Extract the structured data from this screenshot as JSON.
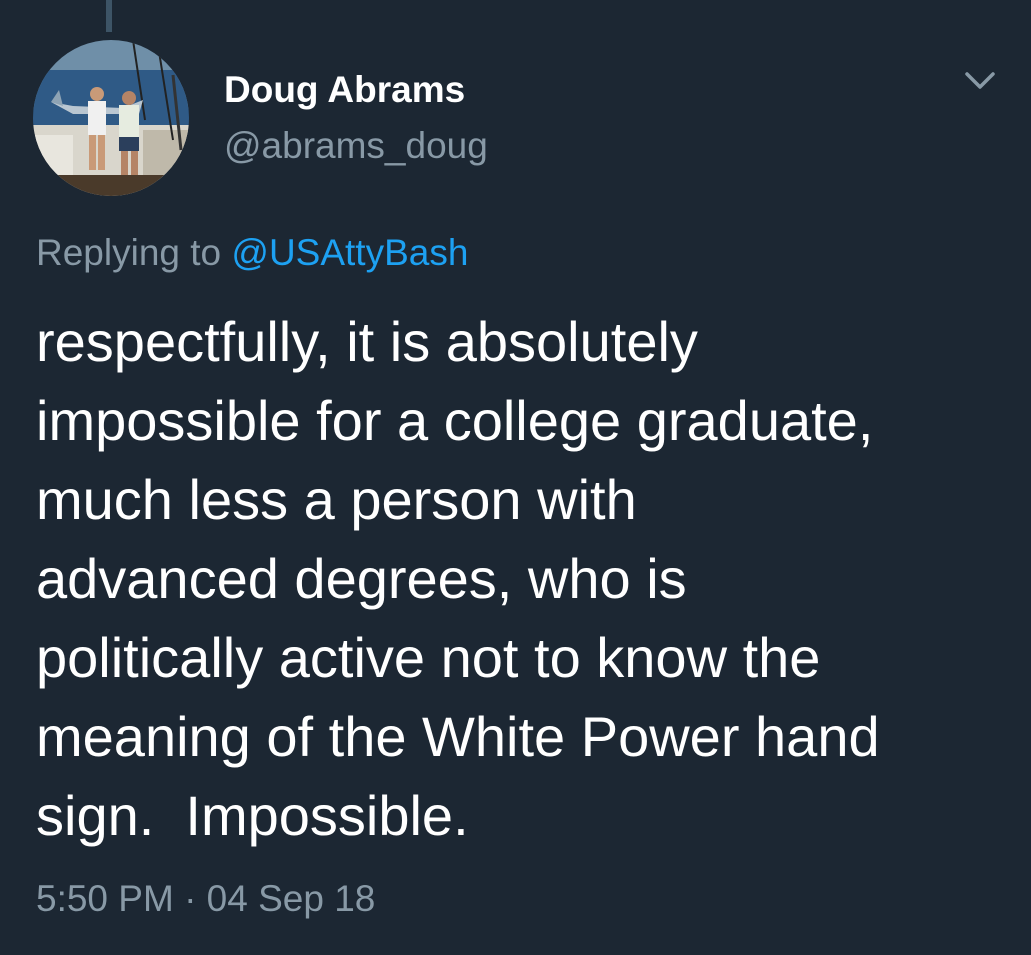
{
  "tweet": {
    "author": {
      "display_name": "Doug Abrams",
      "handle": "@abrams_doug",
      "avatar_icon": "fishing-photo-avatar"
    },
    "reply": {
      "prefix": "Replying to ",
      "to_handle": "@USAttyBash"
    },
    "text": "respectfully, it is absolutely\nimpossible for a college graduate,\nmuch less a person with\nadvanced degrees, who is\npolitically active not to know the\nmeaning of the White Power hand\nsign.  Impossible.",
    "timestamp": "5:50 PM · 04 Sep 18"
  },
  "colors": {
    "background": "#1c2733",
    "primary_text": "#ffffff",
    "secondary_text": "#8899a6",
    "link": "#1da1f2",
    "thread_line": "#3d5466"
  },
  "icons": {
    "menu": "chevron-down-icon"
  }
}
